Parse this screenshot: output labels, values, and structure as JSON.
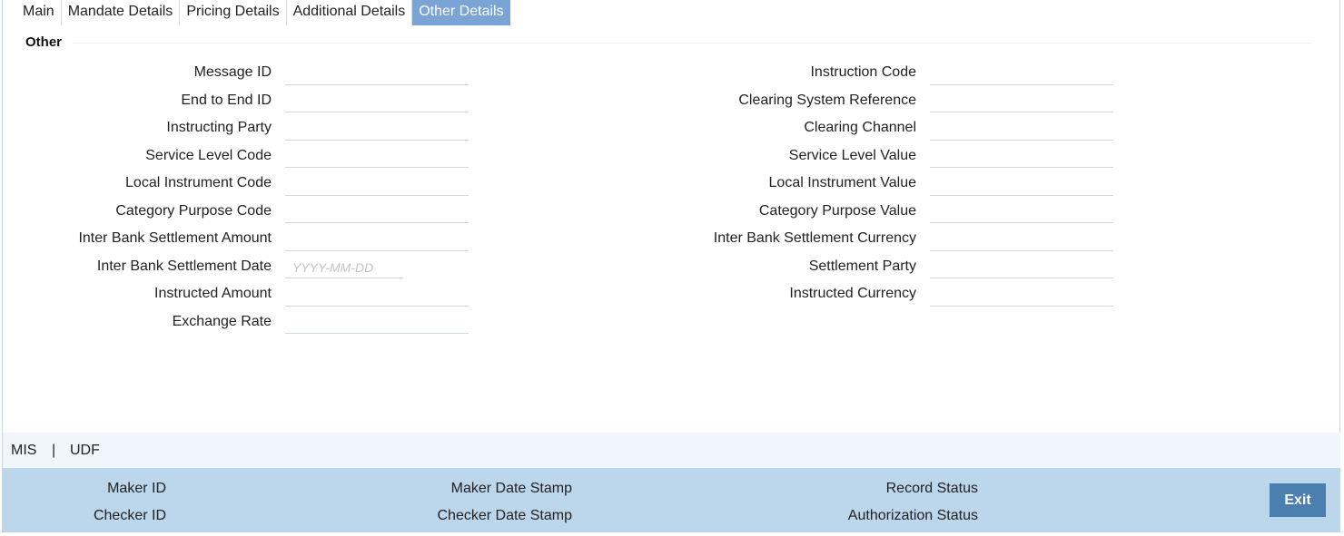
{
  "tabs": [
    {
      "label": "Main",
      "active": false
    },
    {
      "label": "Mandate Details",
      "active": false
    },
    {
      "label": "Pricing Details",
      "active": false
    },
    {
      "label": "Additional Details",
      "active": false
    },
    {
      "label": "Other Details",
      "active": true
    }
  ],
  "section": {
    "title": "Other"
  },
  "left_fields": [
    {
      "label": "Message ID",
      "value": ""
    },
    {
      "label": "End to End ID",
      "value": ""
    },
    {
      "label": "Instructing Party",
      "value": ""
    },
    {
      "label": "Service Level Code",
      "value": ""
    },
    {
      "label": "Local Instrument Code",
      "value": ""
    },
    {
      "label": "Category Purpose Code",
      "value": ""
    },
    {
      "label": "Inter Bank Settlement Amount",
      "value": ""
    },
    {
      "label": "Inter Bank Settlement Date",
      "value": "",
      "placeholder": "YYYY-MM-DD"
    },
    {
      "label": "Instructed Amount",
      "value": ""
    },
    {
      "label": "Exchange Rate",
      "value": ""
    }
  ],
  "right_fields": [
    {
      "label": "Instruction Code",
      "value": ""
    },
    {
      "label": "Clearing System Reference",
      "value": ""
    },
    {
      "label": "Clearing Channel",
      "value": ""
    },
    {
      "label": "Service Level Value",
      "value": ""
    },
    {
      "label": "Local Instrument Value",
      "value": ""
    },
    {
      "label": "Category Purpose Value",
      "value": ""
    },
    {
      "label": "Inter Bank Settlement Currency",
      "value": ""
    },
    {
      "label": "Settlement Party",
      "value": ""
    },
    {
      "label": "Instructed Currency",
      "value": ""
    }
  ],
  "footer_links": {
    "mis": "MIS",
    "separator": "|",
    "udf": "UDF"
  },
  "audit": {
    "maker_id": "Maker ID",
    "checker_id": "Checker ID",
    "maker_date_stamp": "Maker Date Stamp",
    "checker_date_stamp": "Checker Date Stamp",
    "record_status": "Record Status",
    "authorization_status": "Authorization Status"
  },
  "buttons": {
    "exit": "Exit"
  },
  "colors": {
    "active_tab": "#7aa3d6",
    "audit_bar": "#bcd6ec",
    "footer_links_bg": "#f0f6fc",
    "exit_button": "#4a7fb0"
  }
}
